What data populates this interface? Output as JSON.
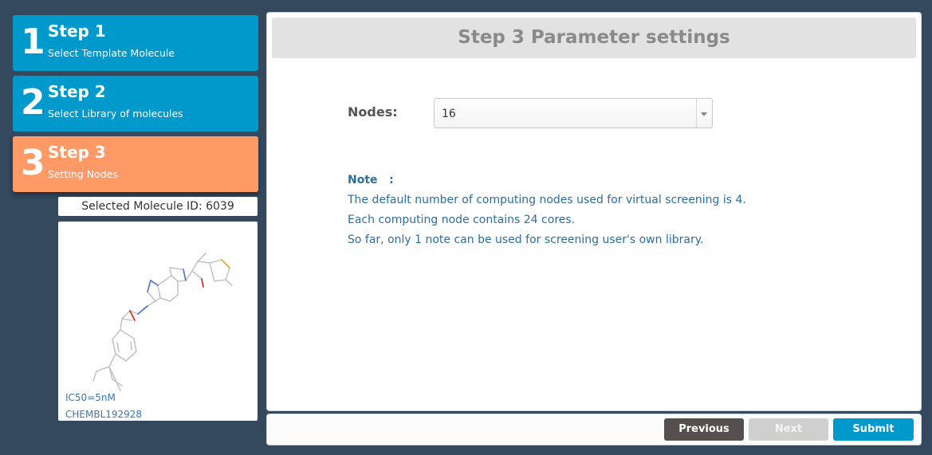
{
  "steps": [
    {
      "number": "1",
      "title": "Step 1",
      "subtitle": "Select Template Molecule",
      "state": "done"
    },
    {
      "number": "2",
      "title": "Step 2",
      "subtitle": "Select Library of molecules",
      "state": "done"
    },
    {
      "number": "3",
      "title": "Step 3",
      "subtitle": "Setting Nodes",
      "state": "active"
    }
  ],
  "molecule": {
    "selected_label": "Selected Molecule ID: 6039",
    "ic50": "IC50=5nM",
    "chembl_id": "CHEMBL192928"
  },
  "panel": {
    "header": "Step 3 Parameter settings",
    "nodes_label": "Nodes:",
    "nodes_value": "16",
    "note_title": "Note   :",
    "note_lines": [
      "The default number of computing nodes used for virtual screening is 4.",
      "Each computing node contains 24 cores.",
      "So far, only 1 note can be used for screening user's own library."
    ]
  },
  "buttons": {
    "previous": "Previous",
    "next": "Next",
    "submit": "Submit"
  },
  "colors": {
    "background": "#34495e",
    "step_done": "#0099cc",
    "step_active": "#ff9966",
    "note_text": "#2c6e9e",
    "submit": "#0099cc",
    "previous": "#55504d",
    "next_disabled": "#cfcfcf"
  },
  "icons": {
    "select_arrow": "chevron-down-icon",
    "molecule_image": "molecule-structure-icon"
  }
}
